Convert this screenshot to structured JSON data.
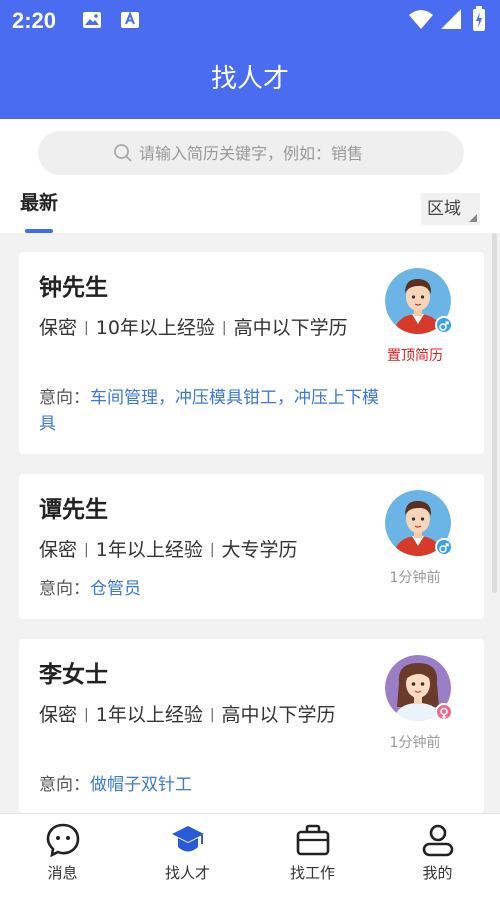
{
  "status_bar": {
    "time": "2:20"
  },
  "header": {
    "title": "找人才"
  },
  "search": {
    "placeholder": "请输入简历关键字，例如：销售"
  },
  "tabs": {
    "newest": "最新",
    "region": "区域"
  },
  "separator": "|",
  "candidates": [
    {
      "name": "钟先生",
      "salary": "保密",
      "experience": "10年以上经验",
      "education": "高中以下学历",
      "intent_label": "意向：",
      "intent": "车间管理，冲压模具钳工，冲压上下模具",
      "gender": "male",
      "right_text": "置顶简历"
    },
    {
      "name": "谭先生",
      "salary": "保密",
      "experience": "1年以上经验",
      "education": "大专学历",
      "intent_label": "意向：",
      "intent": "仓管员",
      "gender": "male",
      "right_text": "1分钟前"
    },
    {
      "name": "李女士",
      "salary": "保密",
      "experience": "1年以上经验",
      "education": "高中以下学历",
      "intent_label": "意向：",
      "intent": "做帽子双针工",
      "gender": "female",
      "right_text": "1分钟前"
    }
  ],
  "bottom_nav": [
    {
      "label": "消息",
      "icon": "chat-icon"
    },
    {
      "label": "找人才",
      "icon": "graduation-cap-icon",
      "active": true
    },
    {
      "label": "找工作",
      "icon": "briefcase-icon"
    },
    {
      "label": "我的",
      "icon": "person-icon"
    }
  ],
  "colors": {
    "brand_blue": "#4a6cf0",
    "link_blue": "#3c78d8",
    "pinned_red": "#e02020",
    "male_badge": "#3aa0ea",
    "female_badge": "#f06a8a"
  }
}
